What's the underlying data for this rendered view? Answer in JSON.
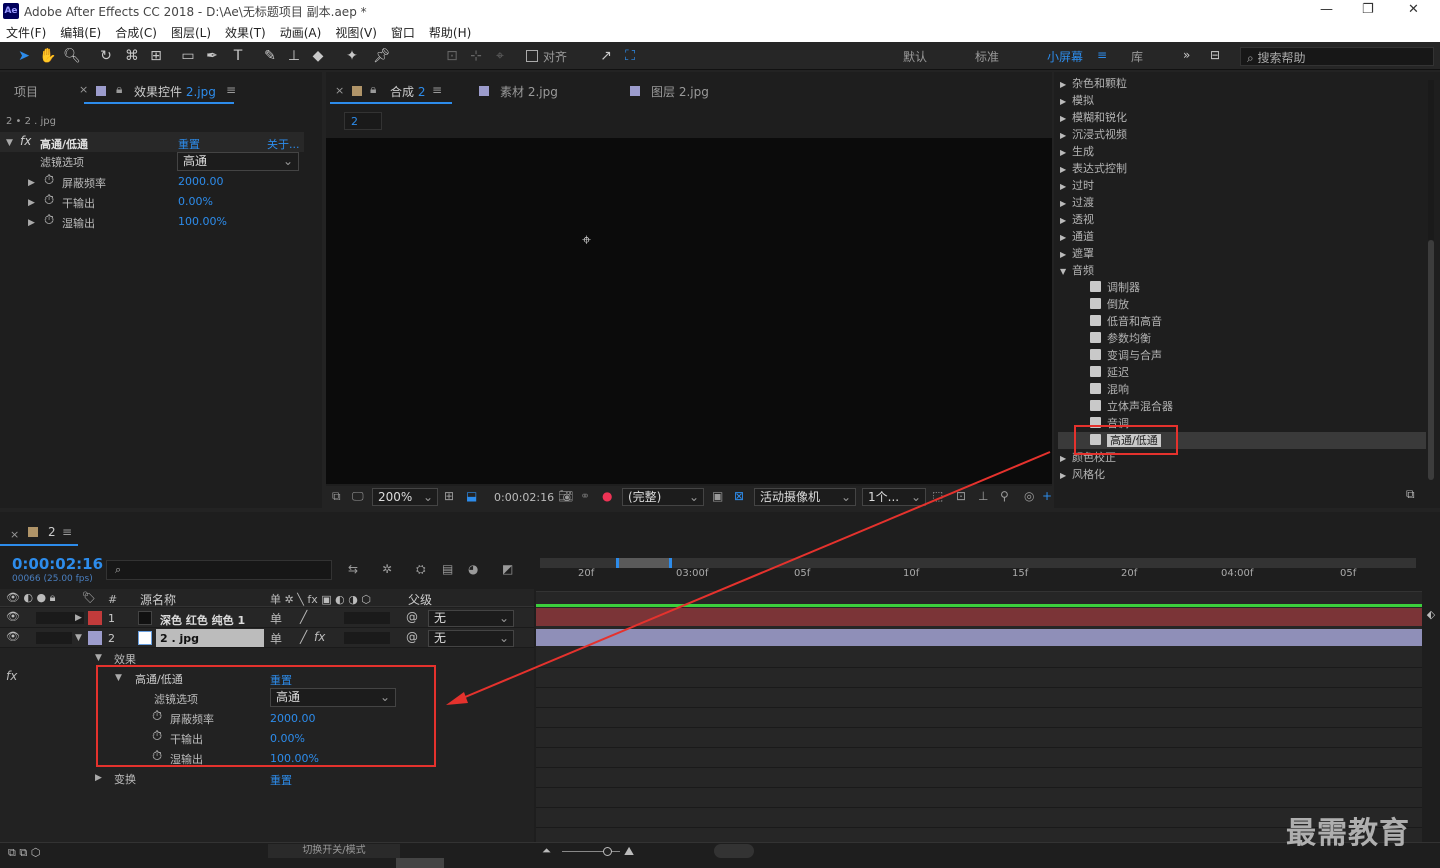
{
  "titlebar": {
    "logo": "Ae",
    "title": "Adobe After Effects CC 2018 - D:\\Ae\\无标题项目 副本.aep *"
  },
  "menu": [
    "文件(F)",
    "编辑(E)",
    "合成(C)",
    "图层(L)",
    "效果(T)",
    "动画(A)",
    "视图(V)",
    "窗口",
    "帮助(H)"
  ],
  "toolbar": {
    "align_label": "对齐",
    "workspaces": [
      "默认",
      "标准",
      "小屏幕",
      "库"
    ],
    "active_workspace": "小屏幕",
    "help_placeholder": "搜索帮助"
  },
  "left_panel": {
    "tab_project": "项目",
    "tab_effects": "效果控件",
    "tab_effects_layer": "2.jpg",
    "layer_path": "2 • 2 . jpg",
    "effect": {
      "name": "高通/低通",
      "reset": "重置",
      "about": "关于...",
      "params": [
        {
          "label": "滤镜选项",
          "value": "高通"
        },
        {
          "label": "屏蔽频率",
          "value": "2000.00"
        },
        {
          "label": "干输出",
          "value": "0.00%"
        },
        {
          "label": "湿输出",
          "value": "100.00%"
        }
      ]
    }
  },
  "comp_panel": {
    "tabs": [
      {
        "label": "合成",
        "suffix": "2"
      },
      {
        "label": "素材 2.jpg"
      },
      {
        "label": "图层 2.jpg"
      }
    ],
    "sub_tab": "2",
    "footer": {
      "zoom": "200%",
      "timecode": "0:00:02:16",
      "resolution": "(完整)",
      "camera": "活动摄像机",
      "views": "1个..."
    }
  },
  "effects_presets": {
    "items": [
      {
        "label": "杂色和颗粒",
        "type": "category"
      },
      {
        "label": "模拟",
        "type": "category"
      },
      {
        "label": "模糊和锐化",
        "type": "category"
      },
      {
        "label": "沉浸式视频",
        "type": "category"
      },
      {
        "label": "生成",
        "type": "category"
      },
      {
        "label": "表达式控制",
        "type": "category"
      },
      {
        "label": "过时",
        "type": "category"
      },
      {
        "label": "过渡",
        "type": "category"
      },
      {
        "label": "透视",
        "type": "category"
      },
      {
        "label": "通道",
        "type": "category"
      },
      {
        "label": "遮罩",
        "type": "category"
      },
      {
        "label": "音频",
        "type": "category-open"
      },
      {
        "label": "调制器",
        "type": "effect"
      },
      {
        "label": "倒放",
        "type": "effect"
      },
      {
        "label": "低音和高音",
        "type": "effect"
      },
      {
        "label": "参数均衡",
        "type": "effect"
      },
      {
        "label": "变调与合声",
        "type": "effect"
      },
      {
        "label": "延迟",
        "type": "effect"
      },
      {
        "label": "混响",
        "type": "effect"
      },
      {
        "label": "立体声混合器",
        "type": "effect"
      },
      {
        "label": "音调",
        "type": "effect"
      },
      {
        "label": "高通/低通",
        "type": "effect-selected"
      },
      {
        "label": "颜色校正",
        "type": "category"
      },
      {
        "label": "风格化",
        "type": "category"
      }
    ]
  },
  "timeline": {
    "tab": "2",
    "timecode": "0:00:02:16",
    "frame_info": "00066 (25.00 fps)",
    "search_placeholder": "",
    "columns": {
      "num": "#",
      "source": "源名称",
      "parent": "父级"
    },
    "ruler": [
      "20f",
      "03:00f",
      "05f",
      "10f",
      "15f",
      "20f",
      "04:00f",
      "05f"
    ],
    "layers": [
      {
        "num": "1",
        "name": "深色 红色 纯色 1",
        "parent": "无",
        "color": "#c23b3b"
      },
      {
        "num": "2",
        "name": "2 . jpg",
        "parent": "无",
        "color": "#9c9ccc"
      }
    ],
    "effects_group": "效果",
    "effect_name": "高通/低通",
    "reset": "重置",
    "params": [
      {
        "label": "滤镜选项",
        "value": "高通"
      },
      {
        "label": "屏蔽频率",
        "value": "2000.00"
      },
      {
        "label": "干输出",
        "value": "0.00%"
      },
      {
        "label": "湿输出",
        "value": "100.00%"
      }
    ],
    "transform": "变换",
    "transform_reset": "重置",
    "footer_toggle": "切换开关/模式"
  },
  "watermark": "最需教育",
  "colors": {
    "accent": "#2d8ceb",
    "highlight_box": "#e5322d",
    "layer1_bar": "#7b3437",
    "layer2_bar": "#8f8fb8",
    "playhead_green": "#3ccf3c"
  }
}
